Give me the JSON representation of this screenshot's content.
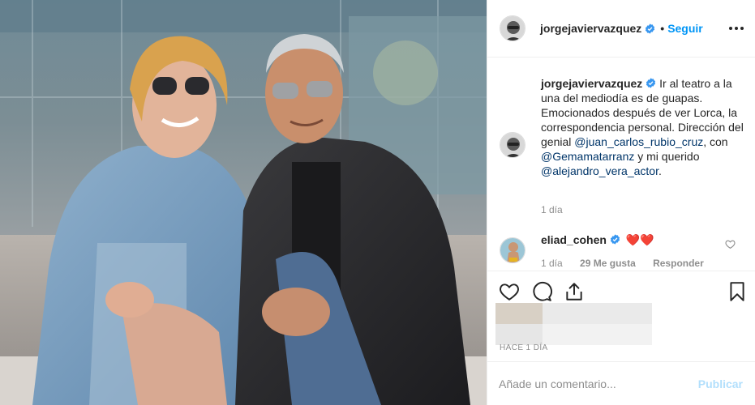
{
  "post": {
    "username": "jorgejaviervazquez",
    "follow_label": "Seguir",
    "dot": "•",
    "caption_rest": " Ir al teatro a la una del mediodía es de guapas. Emocionados después de ver Lorca, la correspondencia personal. Dirección del genial ",
    "mention1": "@juan_carlos_rubio_cruz",
    "sep1": ", con ",
    "mention2": "@Gemamatarranz",
    "sep2": " y mi querido ",
    "mention3": "@alejandro_vera_actor",
    "end": ".",
    "caption_time": "1 día"
  },
  "comment": {
    "username": "eliad_cohen",
    "emoji": "❤️❤️",
    "time": "1 día",
    "likes": "29 Me gusta",
    "reply": "Responder"
  },
  "footer": {
    "when": "Hace 1 día",
    "placeholder": "Añade un comentario...",
    "publish": "Publicar"
  },
  "icons": {
    "like": "heart-icon",
    "comment": "comment-icon",
    "share": "share-icon",
    "save": "bookmark-icon",
    "more": "more-icon",
    "verified": "verified-badge-icon"
  },
  "colors": {
    "link": "#003569",
    "accent": "#0095f6",
    "muted": "#8e8e8e",
    "publish_disabled": "#b2dffc",
    "verified": "#3897f0",
    "heart_red": "#ed4956"
  }
}
